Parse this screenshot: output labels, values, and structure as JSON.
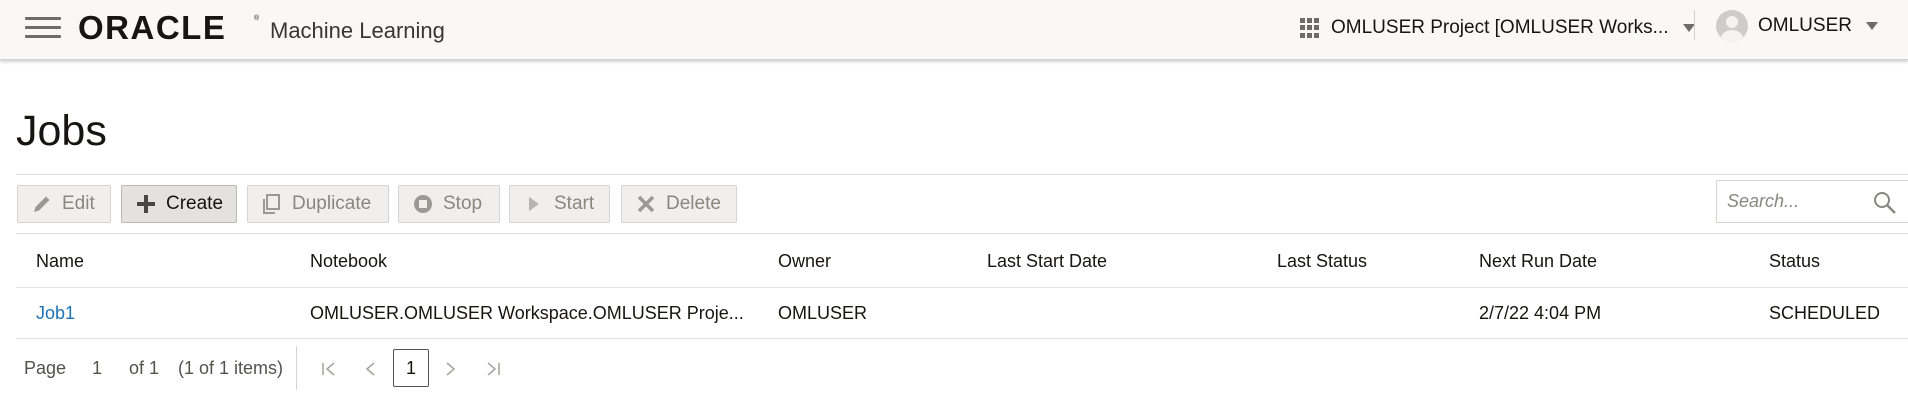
{
  "header": {
    "logo_text": "ORACLE",
    "app_name": "Machine Learning",
    "project_label": "OMLUSER Project [OMLUSER Works...",
    "user_label": "OMLUSER"
  },
  "page": {
    "title": "Jobs"
  },
  "toolbar": {
    "edit": "Edit",
    "create": "Create",
    "duplicate": "Duplicate",
    "stop": "Stop",
    "start": "Start",
    "delete": "Delete",
    "search_placeholder": "Search..."
  },
  "table": {
    "columns": [
      "Name",
      "Notebook",
      "Owner",
      "Last Start Date",
      "Last Status",
      "Next Run Date",
      "Status"
    ],
    "rows": [
      {
        "name": "Job1",
        "notebook": "OMLUSER.OMLUSER Workspace.OMLUSER Proje...",
        "owner": "OMLUSER",
        "last_start_date": "",
        "last_status": "",
        "next_run_date": "2/7/22 4:04 PM",
        "status": "SCHEDULED"
      }
    ]
  },
  "pagination": {
    "page_label": "Page",
    "page_number": "1",
    "of_label": "of 1",
    "items_summary": "(1 of 1 items)",
    "current_page": "1"
  },
  "colors": {
    "link": "#1e73b5",
    "header_bg": "#f9f8f7",
    "text": "#161513",
    "disabled_text": "#8a8680"
  }
}
